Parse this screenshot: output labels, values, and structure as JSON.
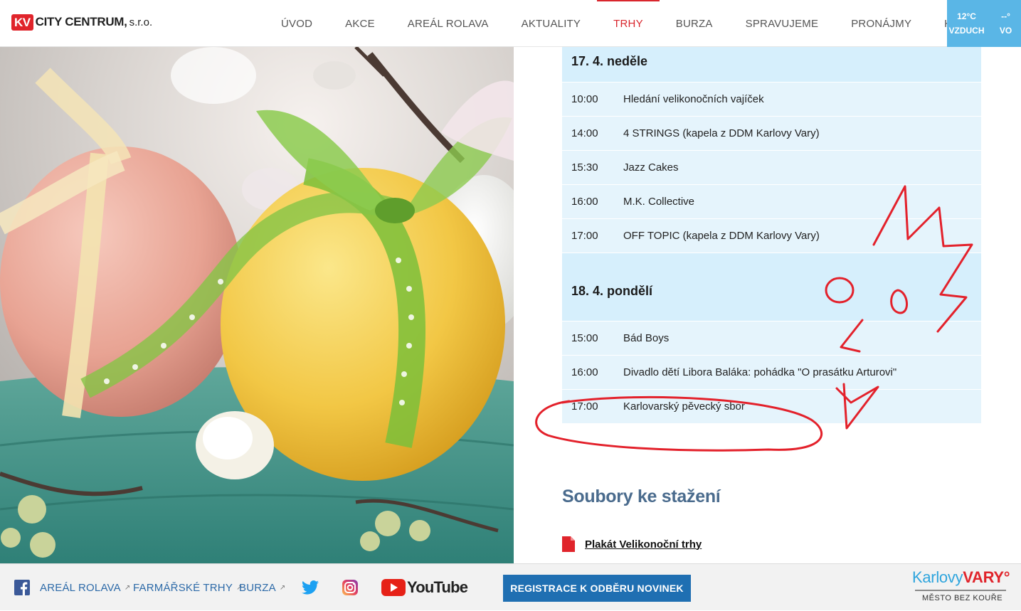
{
  "header": {
    "logo_kv": "KV",
    "logo_name": "CITY CENTRUM,",
    "logo_suffix": "s.r.o.",
    "nav": [
      "ÚVOD",
      "AKCE",
      "AREÁL ROLAVA",
      "AKTUALITY",
      "TRHY",
      "BURZA",
      "SPRAVUJEME",
      "PRONÁJMY",
      "KONTAKT"
    ],
    "active_nav": "TRHY",
    "weather": [
      {
        "value": "12°C",
        "label": "VZDUCH"
      },
      {
        "value": "--°",
        "label": "VO"
      }
    ]
  },
  "schedule": [
    {
      "day": "17. 4. neděle",
      "items": [
        {
          "time": "10:00",
          "name": "Hledání velikonočních vajíček"
        },
        {
          "time": "14:00",
          "name": "4 STRINGS (kapela z DDM Karlovy Vary)"
        },
        {
          "time": "15:30",
          "name": "Jazz Cakes"
        },
        {
          "time": "16:00",
          "name": "M.K. Collective"
        },
        {
          "time": "17:00",
          "name": "OFF TOPIC (kapela z DDM Karlovy Vary)"
        }
      ]
    },
    {
      "day": "18. 4. pondělí",
      "items": [
        {
          "time": "15:00",
          "name": "Bád Boys"
        },
        {
          "time": "16:00",
          "name": "Divadlo dětí Libora Baláka: pohádka \"O prasátku Arturovi\""
        },
        {
          "time": "17:00",
          "name": "Karlovarský pěvecký sbor"
        }
      ]
    }
  ],
  "files": {
    "title": "Soubory ke stažení",
    "link": "Plakát Velikonoční trhy"
  },
  "footer": {
    "links": [
      "AREÁL ROLAVA",
      "FARMÁŘSKÉ TRHY",
      "BURZA"
    ],
    "youtube": "YouTube",
    "register_button": "REGISTRACE K ODBĚRU NOVINEK",
    "city_logo_a": "Karlovy",
    "city_logo_b": "VARY°",
    "city_tagline": "MĚSTO BEZ KOUŘE"
  },
  "colors": {
    "accent_red": "#d9262d",
    "schedule_head": "#d6effc",
    "schedule_row": "#e5f4fc",
    "files_title": "#4a6b8d",
    "button_blue": "#1f6fb2",
    "annotation_red": "#e3212b"
  }
}
